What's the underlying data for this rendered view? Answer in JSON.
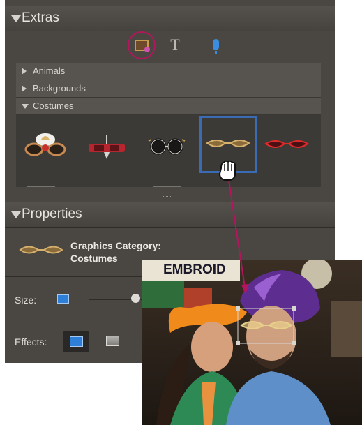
{
  "extras": {
    "title": "Extras"
  },
  "toolbar": {
    "graphics_icon": "graphics-icon",
    "text_tool_glyph": "T",
    "audio_icon": "microphone-icon"
  },
  "categories": [
    {
      "label": "Animals",
      "expanded": false
    },
    {
      "label": "Backgrounds",
      "expanded": false
    },
    {
      "label": "Costumes",
      "expanded": true
    }
  ],
  "costume_thumbnails": [
    {
      "icon": "party-glasses-icon"
    },
    {
      "icon": "red-mask-glasses-icon"
    },
    {
      "icon": "round-glasses-icon"
    },
    {
      "icon": "gold-cat-eye-glasses-icon",
      "selected": true
    },
    {
      "icon": "red-cat-eye-glasses-icon"
    }
  ],
  "properties": {
    "title": "Properties",
    "category_label": "Graphics Category:",
    "category_value": "Costumes",
    "size_label": "Size:",
    "size_value": 0.82,
    "effects_label": "Effects:"
  },
  "photo": {
    "sign_text": "EMBROID"
  },
  "colors": {
    "panel_bg": "#4a4743",
    "highlight_ring": "#b3165c",
    "selection_border": "#3a6bb5",
    "connector_line": "#b3165c"
  }
}
